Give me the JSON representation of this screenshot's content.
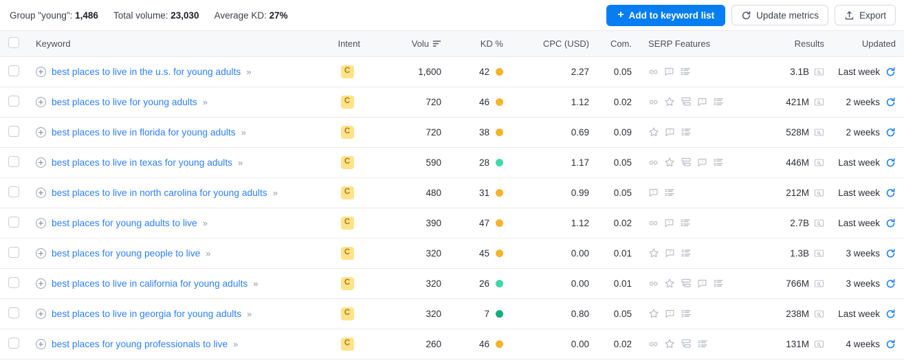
{
  "toolbar": {
    "stats": [
      {
        "label": "Group \"young\":",
        "value": "1,486"
      },
      {
        "label": "Total volume:",
        "value": "23,030"
      },
      {
        "label": "Average KD:",
        "value": "27%"
      }
    ],
    "add_to_list_label": "Add to keyword list",
    "update_metrics_label": "Update metrics",
    "export_label": "Export",
    "primary_color": "#067ef2"
  },
  "table": {
    "columns": {
      "keyword": "Keyword",
      "intent": "Intent",
      "volume": "Volu",
      "kd": "KD %",
      "cpc": "CPC (USD)",
      "com": "Com.",
      "serp": "SERP Features",
      "results": "Results",
      "updated": "Updated"
    },
    "sorted_column": "volume",
    "kd_colors": {
      "low": "#0faf7c",
      "mid": "#3ddaa8",
      "high": "#f5b429"
    },
    "rows": [
      {
        "keyword": "best places to live in the u.s. for young adults",
        "intent": "C",
        "volume": "1,600",
        "kd": "42",
        "kd_level": "high",
        "cpc": "2.27",
        "com": "0.05",
        "serp": [
          "link",
          "faq",
          "list"
        ],
        "results": "3.1B",
        "updated": "Last week"
      },
      {
        "keyword": "best places to live for young adults",
        "intent": "C",
        "volume": "720",
        "kd": "46",
        "kd_level": "high",
        "cpc": "1.12",
        "com": "0.02",
        "serp": [
          "link",
          "star",
          "sitelinks",
          "faq",
          "list"
        ],
        "results": "421M",
        "updated": "2 weeks"
      },
      {
        "keyword": "best places to live in florida for young adults",
        "intent": "C",
        "volume": "720",
        "kd": "38",
        "kd_level": "high",
        "cpc": "0.69",
        "com": "0.09",
        "serp": [
          "star",
          "faq",
          "list"
        ],
        "results": "528M",
        "updated": "2 weeks"
      },
      {
        "keyword": "best places to live in texas for young adults",
        "intent": "C",
        "volume": "590",
        "kd": "28",
        "kd_level": "mid",
        "cpc": "1.17",
        "com": "0.05",
        "serp": [
          "link",
          "star",
          "sitelinks",
          "faq",
          "list"
        ],
        "results": "446M",
        "updated": "Last week"
      },
      {
        "keyword": "best places to live in north carolina for young adults",
        "intent": "C",
        "volume": "480",
        "kd": "31",
        "kd_level": "high",
        "cpc": "0.99",
        "com": "0.05",
        "serp": [
          "faq",
          "list"
        ],
        "results": "212M",
        "updated": "Last week"
      },
      {
        "keyword": "best places for young adults to live",
        "intent": "C",
        "volume": "390",
        "kd": "47",
        "kd_level": "high",
        "cpc": "1.12",
        "com": "0.02",
        "serp": [
          "link",
          "faq",
          "list"
        ],
        "results": "2.7B",
        "updated": "Last week"
      },
      {
        "keyword": "best places for young people to live",
        "intent": "C",
        "volume": "320",
        "kd": "45",
        "kd_level": "high",
        "cpc": "0.00",
        "com": "0.01",
        "serp": [
          "star",
          "faq",
          "list"
        ],
        "results": "1.3B",
        "updated": "3 weeks"
      },
      {
        "keyword": "best places to live in california for young adults",
        "intent": "C",
        "volume": "320",
        "kd": "26",
        "kd_level": "mid",
        "cpc": "0.00",
        "com": "0.01",
        "serp": [
          "link",
          "star",
          "sitelinks",
          "faq",
          "list"
        ],
        "results": "766M",
        "updated": "3 weeks"
      },
      {
        "keyword": "best places to live in georgia for young adults",
        "intent": "C",
        "volume": "320",
        "kd": "7",
        "kd_level": "low",
        "cpc": "0.80",
        "com": "0.05",
        "serp": [
          "star",
          "faq",
          "list"
        ],
        "results": "238M",
        "updated": "Last week"
      },
      {
        "keyword": "best places for young professionals to live",
        "intent": "C",
        "volume": "260",
        "kd": "46",
        "kd_level": "high",
        "cpc": "0.00",
        "com": "0.02",
        "serp": [
          "link",
          "star",
          "sitelinks",
          "list"
        ],
        "results": "131M",
        "updated": "4 weeks"
      }
    ]
  }
}
